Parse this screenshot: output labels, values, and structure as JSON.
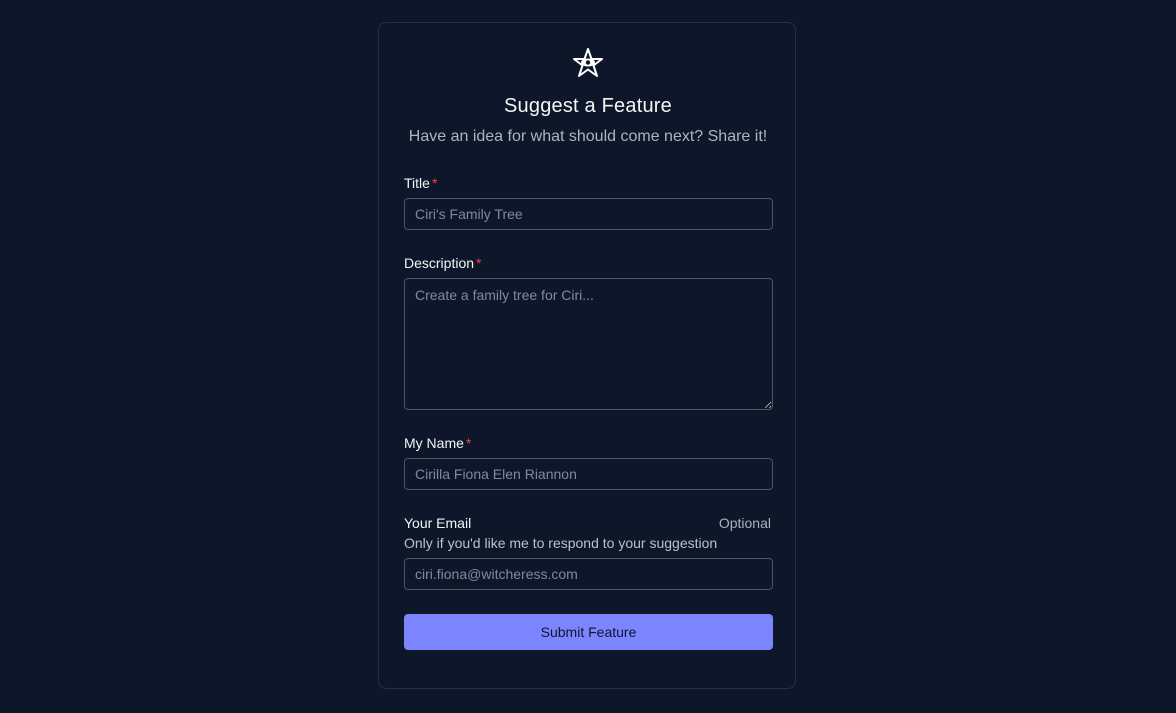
{
  "header": {
    "logo_icon": "witcher-star-logo-icon",
    "title": "Suggest a Feature",
    "subtitle": "Have an idea for what should come next? Share it!"
  },
  "form": {
    "required_marker": "*",
    "title_field": {
      "label": "Title",
      "placeholder": "Ciri's Family Tree",
      "value": ""
    },
    "description_field": {
      "label": "Description",
      "placeholder": "Create a family tree for Ciri...",
      "value": ""
    },
    "name_field": {
      "label": "My Name",
      "placeholder": "Cirilla Fiona Elen Riannon",
      "value": ""
    },
    "email_field": {
      "label": "Your Email",
      "optional_label": "Optional",
      "hint": "Only if you'd like me to respond to your suggestion",
      "placeholder": "ciri.fiona@witcheress.com",
      "value": ""
    },
    "submit_label": "Submit Feature"
  },
  "colors": {
    "background": "#0e172a",
    "accent": "#7c85ff",
    "required": "#ef4444"
  }
}
